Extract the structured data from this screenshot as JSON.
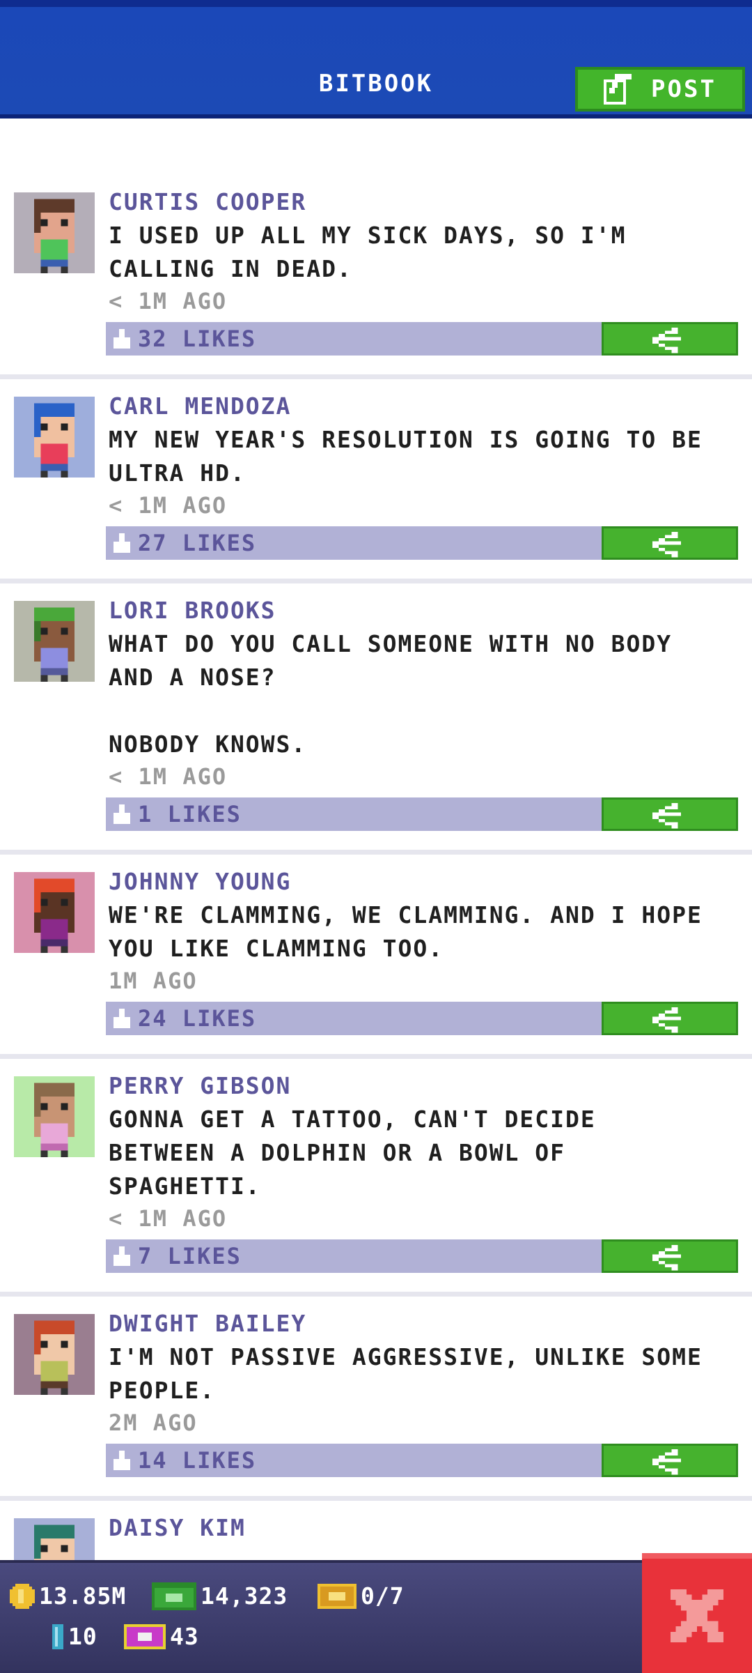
{
  "header": {
    "title": "BITBOOK",
    "post_label": "POST",
    "post_icon": "compose-icon"
  },
  "posts": [
    {
      "name": "CURTIS COOPER",
      "text": "I USED UP ALL MY SICK DAYS, SO I'M\nCALLING IN DEAD.",
      "time": "< 1M AGO",
      "likes": "32 LIKES",
      "avatar": {
        "bg": "#b4aeb8",
        "skin": "#e2a48c",
        "hair": "#5e3a2a",
        "shirt": "#4fc45a",
        "pants": "#3a5fb0",
        "hat": ""
      }
    },
    {
      "name": "CARL MENDOZA",
      "text": "MY NEW YEAR'S RESOLUTION IS GOING TO BE\nULTRA HD.",
      "time": "< 1M AGO",
      "likes": "27 LIKES",
      "avatar": {
        "bg": "#9eaedc",
        "skin": "#f0c0a0",
        "hair": "#2a62c8",
        "shirt": "#e83e5a",
        "pants": "#3a5fb0",
        "hat": "#2a62c8"
      }
    },
    {
      "name": "LORI BROOKS",
      "text": "WHAT DO YOU CALL SOMEONE WITH NO BODY\nAND A NOSE?\n\nNOBODY KNOWS.",
      "time": "< 1M AGO",
      "likes": "1 LIKES",
      "avatar": {
        "bg": "#b6b8aa",
        "skin": "#8a5a3e",
        "hair": "#3a7a2a",
        "shirt": "#8d8ee0",
        "pants": "#555a9a",
        "hat": "#4aa83a"
      }
    },
    {
      "name": "JOHNNY YOUNG",
      "text": "WE'RE CLAMMING, WE CLAMMING. AND I HOPE\nYOU LIKE CLAMMING TOO.",
      "time": "1M AGO",
      "likes": "24 LIKES",
      "avatar": {
        "bg": "#d890ac",
        "skin": "#5a3424",
        "hair": "#e24a2a",
        "shirt": "#8a2a8a",
        "pants": "#4a2a6a",
        "hat": "#e24a2a"
      }
    },
    {
      "name": "PERRY GIBSON",
      "text": "GONNA GET A TATTOO, CAN'T DECIDE\nBETWEEN A DOLPHIN OR A BOWL OF\nSPAGHETTI.",
      "time": "< 1M AGO",
      "likes": "7 LIKES",
      "avatar": {
        "bg": "#b8eaa8",
        "skin": "#c89474",
        "hair": "#8a6a4a",
        "shirt": "#e8a8d8",
        "pants": "#c06ab0",
        "hat": ""
      }
    },
    {
      "name": "DWIGHT BAILEY",
      "text": "I'M NOT PASSIVE AGGRESSIVE, UNLIKE SOME\nPEOPLE.",
      "time": "2M AGO",
      "likes": "14 LIKES",
      "avatar": {
        "bg": "#9a7e90",
        "skin": "#f0c8a8",
        "hair": "#c84a2a",
        "shirt": "#b8c05a",
        "pants": "#5a3a2a",
        "hat": "#c84a2a"
      }
    },
    {
      "name": "DAISY KIM",
      "text": "",
      "time": "",
      "likes": "",
      "avatar": {
        "bg": "#a8b0d8",
        "skin": "#f0c8a8",
        "hair": "#2a7a6a",
        "shirt": "#4a8ae8",
        "pants": "#3a5fb0",
        "hat": "#2a7a6a"
      }
    }
  ],
  "status": {
    "coins": "13.85M",
    "cash": "14,323",
    "tickets": "0/7",
    "gems": "10",
    "bux": "43",
    "close_icon": "close-x-icon",
    "colors": {
      "coin": "#f0c030",
      "cash": "#3aa83a",
      "ticket": "#f0c030",
      "gem": "#3aa8c8",
      "bux": "#c83ac8",
      "close": "#e8323a"
    }
  }
}
